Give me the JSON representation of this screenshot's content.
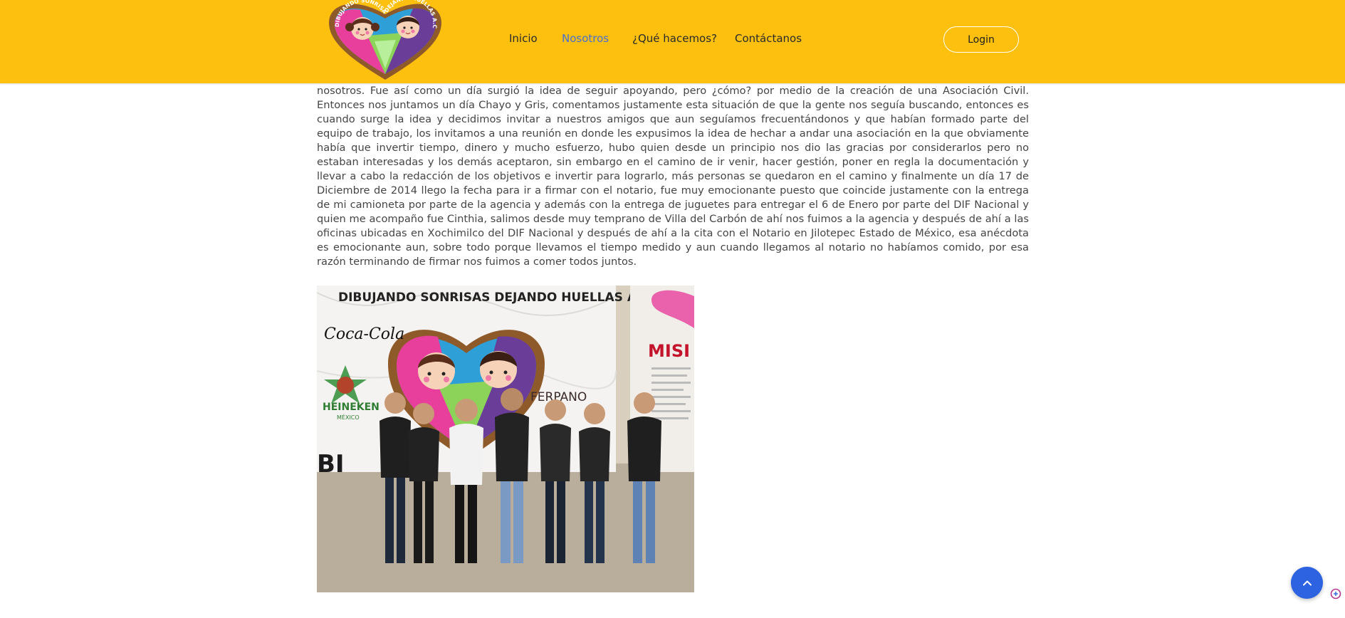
{
  "header": {
    "logo": {
      "top_text_left": "DIBUJANDO SONRISAS",
      "top_text_right": "DEJANDO HUELLAS A.C."
    },
    "nav": [
      {
        "label": "Inicio",
        "active": false
      },
      {
        "label": "Nosotros",
        "active": true
      },
      {
        "label": "¿Qué hacemos?",
        "active": false
      },
      {
        "label": "Contáctanos",
        "active": false
      }
    ],
    "login_label": "Login"
  },
  "main": {
    "paragraph": "nosotros. Fue así como un día surgió la idea de seguir apoyando, pero ¿cómo? por medio de la creación de una Asociación Civil. Entonces nos juntamos un día Chayo y Gris, comentamos justamente esta situación de que la gente nos seguía buscando, entonces es cuando surge la idea y decidimos invitar a nuestros amigos que aun seguíamos frecuentándonos y que habían formado parte del equipo de trabajo, los invitamos a una reunión en donde les expusimos la idea de hechar a andar una asociación en la que obviamente había que invertir tiempo, dinero y mucho esfuerzo, hubo quien desde un principio nos dio las gracias por considerarlos pero no estaban interesadas y los demás aceptaron, sin embargo en el camino de ir venir, hacer gestión, poner en regla la documentación y llevar a cabo la redacción de los objetivos e invertir para lograrlo, más personas se quedaron en el camino y finalmente un día 17 de Diciembre de 2014 llego la fecha para ir a firmar con el notario, fue muy emocionante puesto que coincide justamente con la entrega de mi camioneta por parte de la agencia y además con la entrega de juguetes para entregar el 6 de Enero por parte del DIF Nacional y quien me acompaño fue Cinthia, salimos desde muy temprano de Villa del Carbón de ahí nos fuimos a la agencia y después de ahí a las oficinas ubicadas en Xochimilco del DIF Nacional y después de ahí a la cita con el Notario en Jilotepec Estado de México, esa anécdota es emocionante aun, sobre todo porque llevamos el tiempo medido y aun cuando llegamos al notario no habíamos comido, por esa razón terminando de firmar nos fuimos a comer todos juntos.",
    "photo": {
      "banner_text": "DIBUJANDO SONRISAS DEJANDO HUELLAS A.C.",
      "sponsor_1": "Coca-Cola",
      "sponsor_2": "HEINEKEN",
      "sponsor_2_sub": "MÉXICO",
      "sponsor_3": "FERPANO",
      "side_text": "MISI",
      "bottom_left_text": "BI"
    }
  },
  "colors": {
    "header_bg": "#fdc00f",
    "nav_active": "#4a6fd0",
    "scroll_button": "#2d63e0"
  },
  "icons": {
    "scroll_top": "chevron-up-icon",
    "corner": "extension-icon"
  }
}
